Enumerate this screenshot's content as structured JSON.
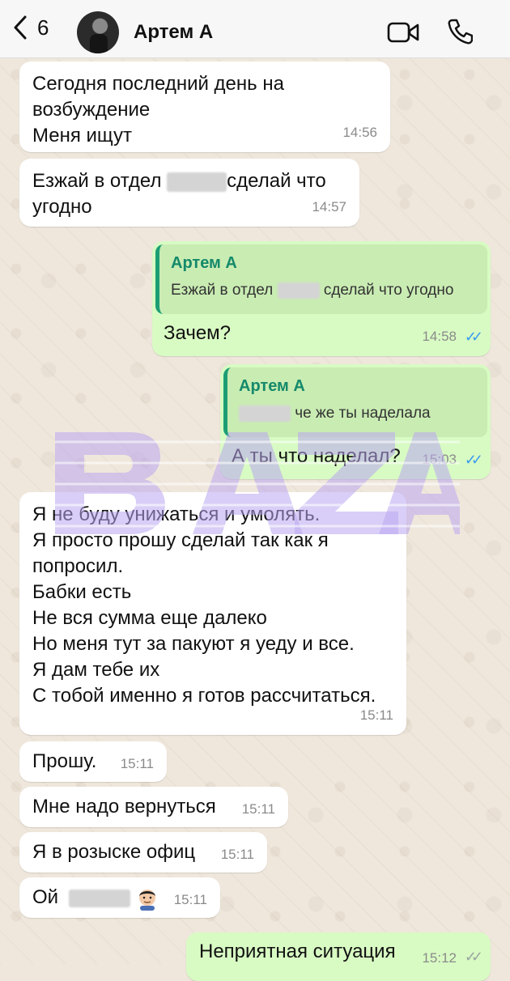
{
  "header": {
    "back_count": "6",
    "contact_name": "Артем А"
  },
  "messages": [
    {
      "id": 1,
      "text_lines": [
        "Сегодня последний день на",
        "возбуждение",
        "Меня ищут"
      ],
      "time": "14:56"
    },
    {
      "id": 2,
      "part1": "Езжай в отдел",
      "part2": "сделай что",
      "part3": "угодно",
      "time": "14:57"
    },
    {
      "id": 3,
      "quote_name": "Артем А",
      "quote_part1": "Езжай в отдел",
      "quote_part2": "сделай что угодно",
      "text": "Зачем?",
      "time": "14:58"
    },
    {
      "id": 4,
      "quote_name": "Артем А",
      "quote_part2": "че же ты наделала",
      "text": "А ты что наделал?",
      "time": "15:03"
    },
    {
      "id": 5,
      "text_lines": [
        "Я не буду унижаться и умолять.",
        "Я просто прошу сделай так как я",
        "попросил.",
        "Бабки есть",
        "Не вся сумма еще далеко",
        "Но меня тут за пакуют я уеду и все.",
        "Я дам тебе их",
        "С тобой именно я готов рассчитаться."
      ],
      "time": "15:11"
    },
    {
      "id": 6,
      "text": "Прошу.",
      "time": "15:11"
    },
    {
      "id": 7,
      "text": "Мне надо вернуться",
      "time": "15:11"
    },
    {
      "id": 8,
      "text": "Я в розыске офиц",
      "time": "15:11"
    },
    {
      "id": 9,
      "text": "Ой",
      "time": "15:11"
    },
    {
      "id": 10,
      "text": "Неприятная ситуация",
      "time": "15:12"
    }
  ],
  "watermark": "BAZA",
  "colors": {
    "incoming": "#ffffff",
    "outgoing": "#d8fbc3",
    "quote_accent": "#1c9e74",
    "read_ticks": "#3b9cf0",
    "watermark": "#b9a6f0"
  }
}
